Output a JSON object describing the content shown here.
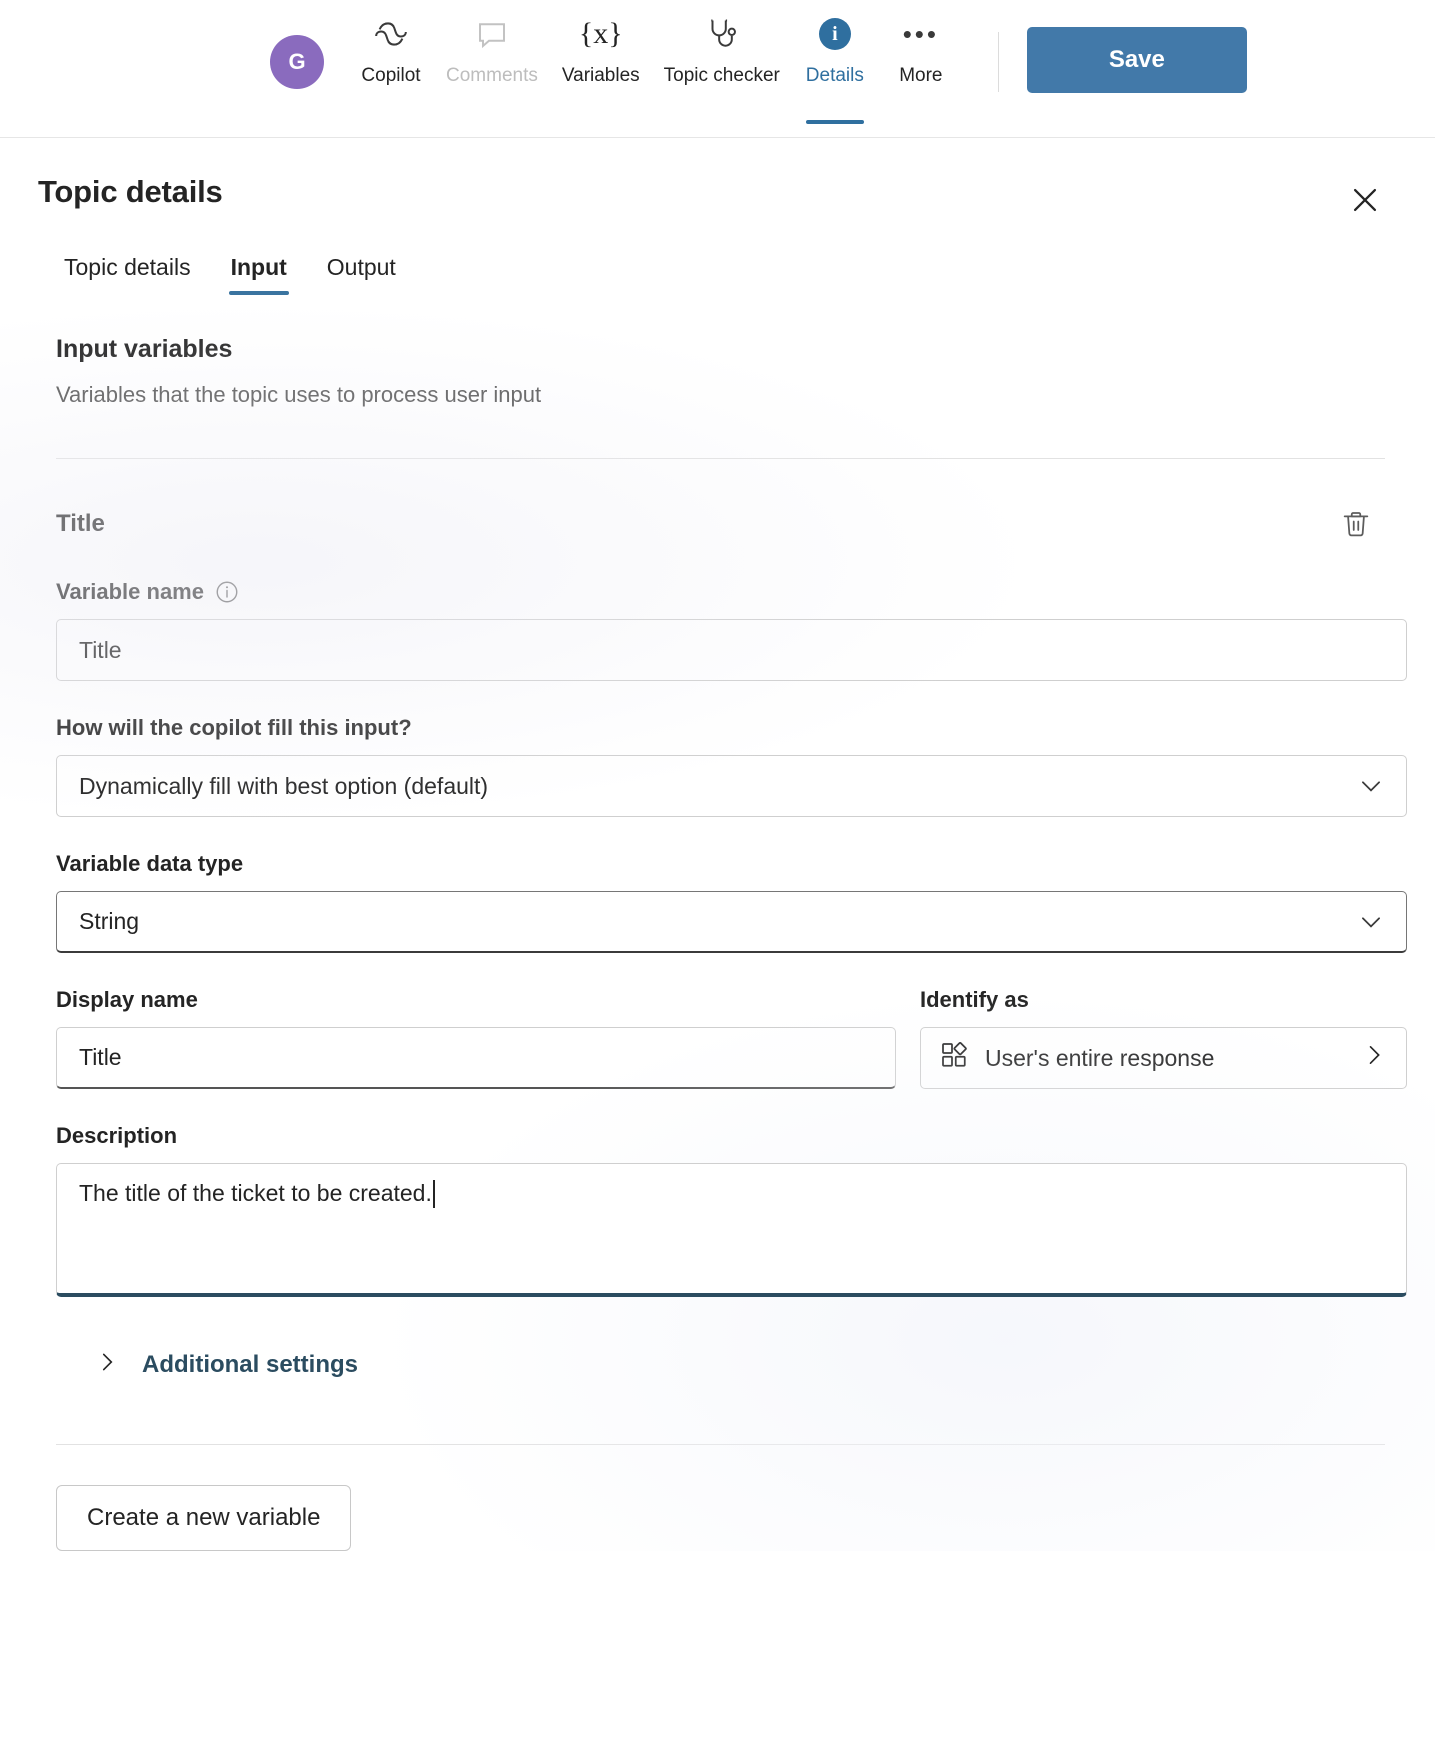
{
  "topbar": {
    "avatar_initial": "G",
    "commands": [
      {
        "label": "Copilot",
        "icon": "copilot-icon",
        "state": "normal"
      },
      {
        "label": "Comments",
        "icon": "comment-icon",
        "state": "disabled"
      },
      {
        "label": "Variables",
        "icon": "variables-icon",
        "state": "normal"
      },
      {
        "label": "Topic checker",
        "icon": "stethoscope-icon",
        "state": "normal"
      },
      {
        "label": "Details",
        "icon": "info-badge-icon",
        "state": "selected"
      },
      {
        "label": "More",
        "icon": "ellipsis-icon",
        "state": "normal"
      }
    ],
    "variables_glyph": "{x}",
    "info_glyph": "i",
    "ellipsis_glyph": "•••",
    "save_label": "Save",
    "save_color": "#4279a9"
  },
  "panel": {
    "title": "Topic details",
    "close_label": "Close",
    "tabs": [
      {
        "label": "Topic details",
        "active": false
      },
      {
        "label": "Input",
        "active": true
      },
      {
        "label": "Output",
        "active": false
      }
    ],
    "accent_color": "#3a74a0"
  },
  "input_variables": {
    "heading": "Input variables",
    "subheading": "Variables that the topic uses to process user input"
  },
  "variable": {
    "name_heading": "Title",
    "delete_tooltip": "Delete",
    "variable_name": {
      "label": "Variable name",
      "value": "Title",
      "placeholder": "Variable name",
      "has_info": true
    },
    "fill_mode": {
      "label": "How will the copilot fill this input?",
      "value": "Dynamically fill with best option (default)"
    },
    "data_type": {
      "label": "Variable data type",
      "value": "String"
    },
    "display_name": {
      "label": "Display name",
      "value": "Title",
      "placeholder": "Display name"
    },
    "identify_as": {
      "label": "Identify as",
      "value": "User's entire response",
      "icon": "entity-shapes-icon"
    },
    "description": {
      "label": "Description",
      "value": "The title of the ticket to be created.",
      "placeholder": "Description",
      "focused": true,
      "focus_color": "#2b4c60"
    },
    "additional_settings": {
      "label": "Additional settings",
      "expanded": false,
      "color": "#2b4c60"
    }
  },
  "footer": {
    "create_variable_label": "Create a new variable"
  }
}
